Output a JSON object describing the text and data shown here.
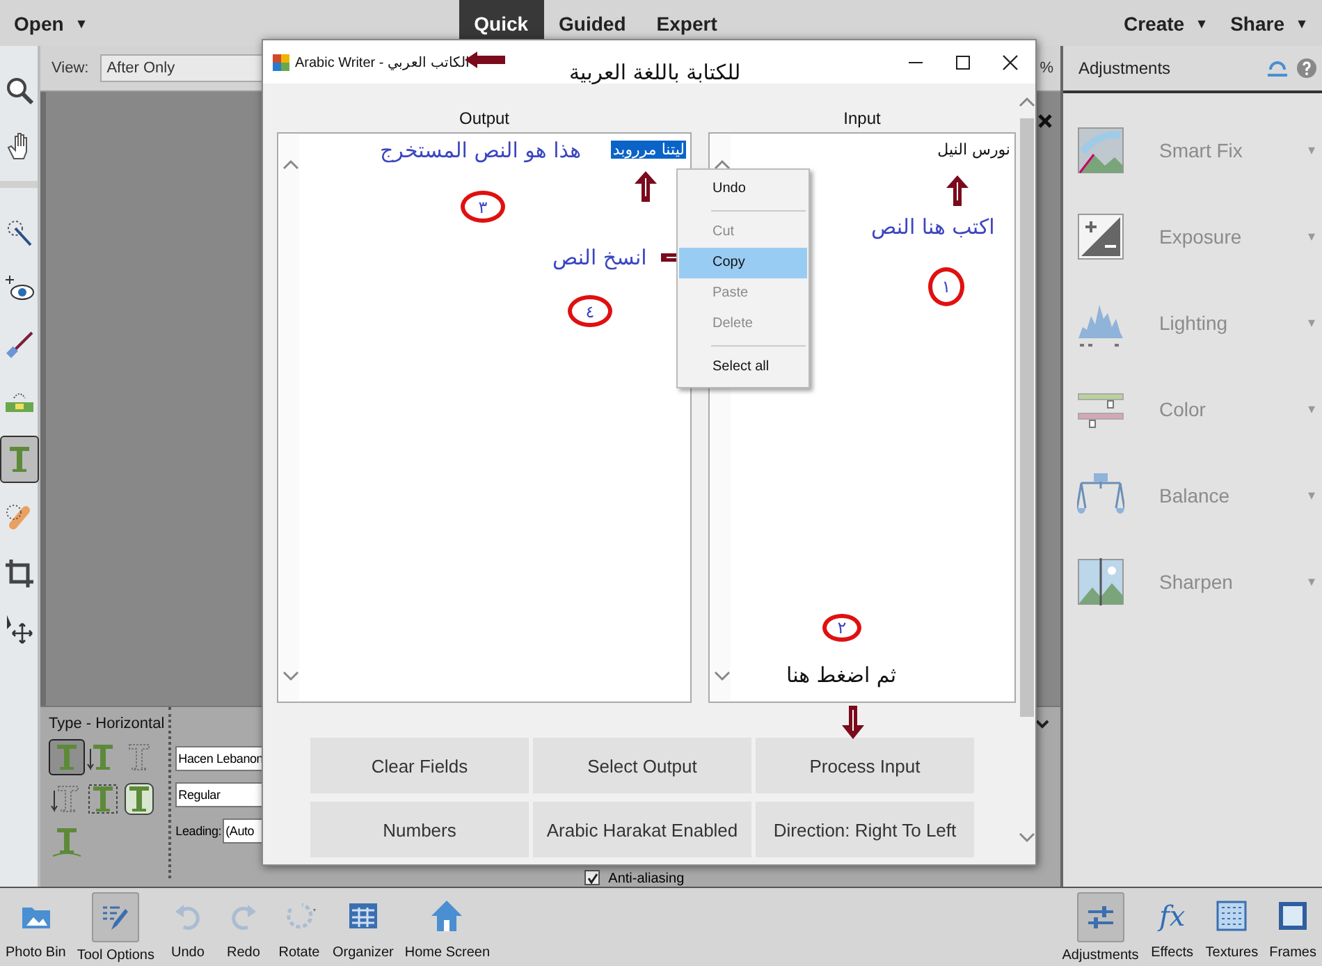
{
  "top_bar": {
    "open": {
      "label": "Open",
      "caret": "▾"
    },
    "modes": [
      {
        "label": "Quick",
        "selected": true
      },
      {
        "label": "Guided",
        "selected": false
      },
      {
        "label": "Expert",
        "selected": false
      }
    ],
    "menus": [
      {
        "label": "Create",
        "caret": "▾"
      },
      {
        "label": "Share",
        "caret": "▾"
      }
    ]
  },
  "toolbox": [
    {
      "tools": [
        {
          "kind": "zoom",
          "selected": false
        },
        {
          "kind": "hand",
          "selected": false
        }
      ]
    },
    {
      "tools": [
        {
          "kind": "quick-select",
          "selected": false
        },
        {
          "kind": "red-eye",
          "selected": false
        },
        {
          "kind": "brush",
          "selected": false
        },
        {
          "kind": "straighten",
          "selected": false
        },
        {
          "kind": "type",
          "selected": true
        },
        {
          "kind": "healing",
          "selected": false
        },
        {
          "kind": "crop",
          "selected": false
        },
        {
          "kind": "move",
          "selected": false
        }
      ]
    }
  ],
  "view_bar": {
    "label": "View:",
    "value": "After Only",
    "zoom_suffix": "%"
  },
  "tool_options": {
    "title": "Type - Horizontal",
    "type_tools": [
      {
        "kind": "horizontal",
        "selected": true
      },
      {
        "kind": "vertical",
        "selected": false
      },
      {
        "kind": "horizontal-mask",
        "selected": false
      },
      {
        "kind": "vertical-mask",
        "selected": false
      },
      {
        "kind": "selection",
        "selected": false
      },
      {
        "kind": "shape",
        "selected": false
      },
      {
        "kind": "path",
        "selected": false
      }
    ],
    "font": "Hacen Lebanon",
    "style": "Regular",
    "leading_label": "Leading:",
    "leading_value": "(Auto",
    "antialias": {
      "label": "Anti-aliasing",
      "checked": true
    }
  },
  "adjustments": {
    "title": "Adjustments",
    "items": [
      {
        "kind": "smart-fix",
        "label": "Smart Fix",
        "caret": "▾"
      },
      {
        "kind": "exposure",
        "label": "Exposure",
        "caret": "▾"
      },
      {
        "kind": "lighting",
        "label": "Lighting",
        "caret": "▾"
      },
      {
        "kind": "color",
        "label": "Color",
        "caret": "▾"
      },
      {
        "kind": "balance",
        "label": "Balance",
        "caret": "▾"
      },
      {
        "kind": "sharpen",
        "label": "Sharpen",
        "caret": "▾"
      }
    ]
  },
  "taskbar": {
    "left": [
      {
        "kind": "photo-bin",
        "label": "Photo Bin",
        "selected": false
      },
      {
        "kind": "tool-options",
        "label": "Tool Options",
        "selected": true
      },
      {
        "kind": "undo",
        "label": "Undo",
        "selected": false
      },
      {
        "kind": "redo",
        "label": "Redo",
        "selected": false
      },
      {
        "kind": "rotate",
        "label": "Rotate",
        "selected": false
      },
      {
        "kind": "organizer",
        "label": "Organizer",
        "selected": false
      },
      {
        "kind": "home",
        "label": "Home Screen",
        "selected": false
      }
    ],
    "right": [
      {
        "kind": "adjustments",
        "label": "Adjustments",
        "selected": true
      },
      {
        "kind": "effects",
        "glyph": "fx",
        "label": "Effects",
        "selected": false
      },
      {
        "kind": "textures",
        "label": "Textures",
        "selected": false
      },
      {
        "kind": "frames",
        "label": "Frames",
        "selected": false
      }
    ]
  },
  "dialog": {
    "title": "Arabic Writer - الكاتب العربي",
    "caption": "للكتابة باللغة العربية",
    "output": {
      "label": "Output",
      "value": "ليتنا مرروبد",
      "note": "هذا هو النص المستخرج",
      "step": "٣",
      "copy_note": "انسخ النص",
      "copy_step": "٤"
    },
    "input": {
      "label": "Input",
      "value": "نورس النيل",
      "note": "اكتب هنا النص",
      "step": "١",
      "press_step": "٢",
      "press_note": "ثم اضغط هنا"
    },
    "context_menu": [
      [
        {
          "label": "Undo",
          "disabled": false,
          "selected": false
        }
      ],
      [
        {
          "label": "Cut",
          "disabled": true,
          "selected": false
        },
        {
          "label": "Copy",
          "disabled": false,
          "selected": true
        },
        {
          "label": "Paste",
          "disabled": true,
          "selected": false
        },
        {
          "label": "Delete",
          "disabled": true,
          "selected": false
        }
      ],
      [
        {
          "label": "Select all",
          "disabled": false,
          "selected": false
        }
      ]
    ],
    "buttons": [
      "Clear Fields",
      "Select Output",
      "Process Input",
      "Numbers",
      "Arabic Harakat Enabled",
      "Direction: Right To Left"
    ]
  }
}
